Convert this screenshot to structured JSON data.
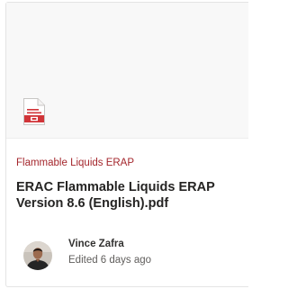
{
  "card": {
    "file_icon": "pdf-file-icon",
    "site_name": "Flammable Liquids ERAP",
    "file_name": "ERAC Flammable Liquids ERAP Version 8.6 (English).pdf",
    "author_name": "Vince Zafra",
    "edited_text": "Edited 6 days ago",
    "avatar_icon": "user-avatar-photo"
  },
  "colors": {
    "site_name": "#a4262c",
    "pdf_red": "#d13438",
    "preview_bg": "#f8f8f8",
    "title_text": "#252423",
    "secondary_text": "#605e5c"
  }
}
